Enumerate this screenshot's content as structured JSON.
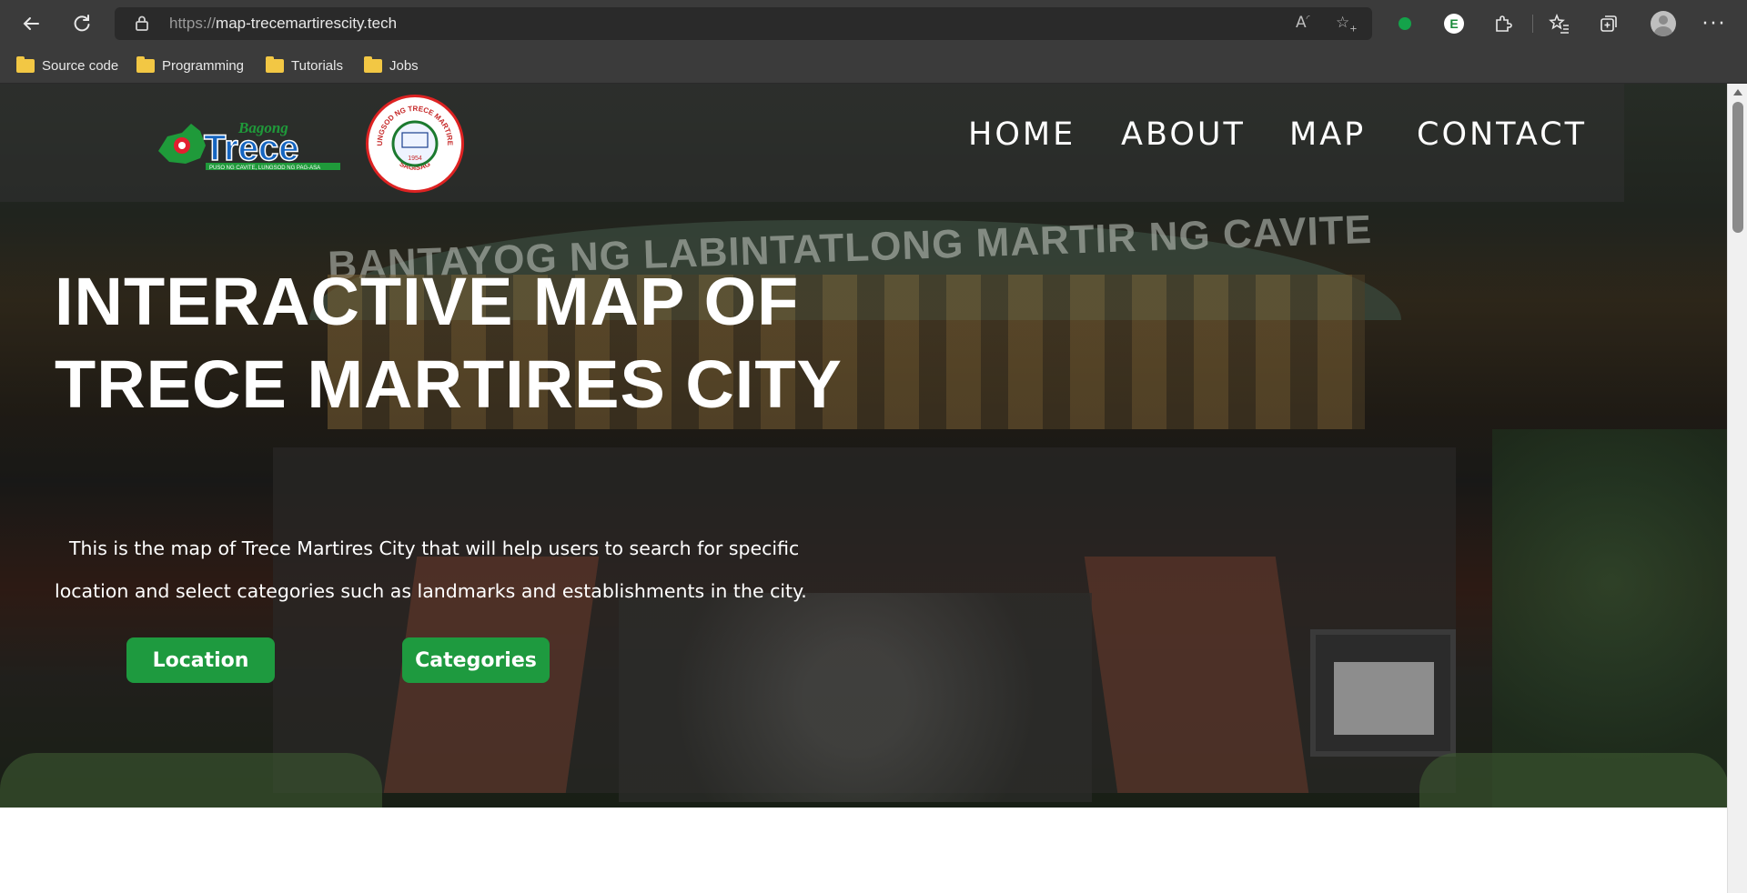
{
  "browser": {
    "url_scheme": "https://",
    "url_host": "map-trecemartirescity.tech",
    "bookmarks": [
      {
        "label": "Source code"
      },
      {
        "label": "Programming"
      },
      {
        "label": "Tutorials"
      },
      {
        "label": "Jobs"
      }
    ],
    "extension_e_label": "E"
  },
  "hero": {
    "nav": {
      "links": [
        "HOME",
        "ABOUT",
        "MAP",
        "CONTACT"
      ]
    },
    "logo_trece": {
      "top_word": "Bagong",
      "main_word": "Trece",
      "tagline": "PUSO NG CAVITE, LUNGSOD NG PAG-ASA"
    },
    "seal": {
      "ring_top": "LUNGSOD NG TRECE MARTIRES",
      "ring_bottom": "SAGISAG",
      "year": "1954"
    },
    "background_sign": "BANTAYOG NG LABINTATLONG MARTIR NG CAVITE",
    "title": "INTERACTIVE MAP OF TRECE MARTIRES CITY",
    "description": "This is the map of Trece Martires City that will help users to search for specific location and select categories such as landmarks and establishments in the city.",
    "buttons": {
      "location": "Location",
      "categories": "Categories"
    }
  },
  "colors": {
    "button_green": "#1e9a3f",
    "browser_chrome": "#3b3b3b",
    "folder_yellow": "#f2c744"
  }
}
